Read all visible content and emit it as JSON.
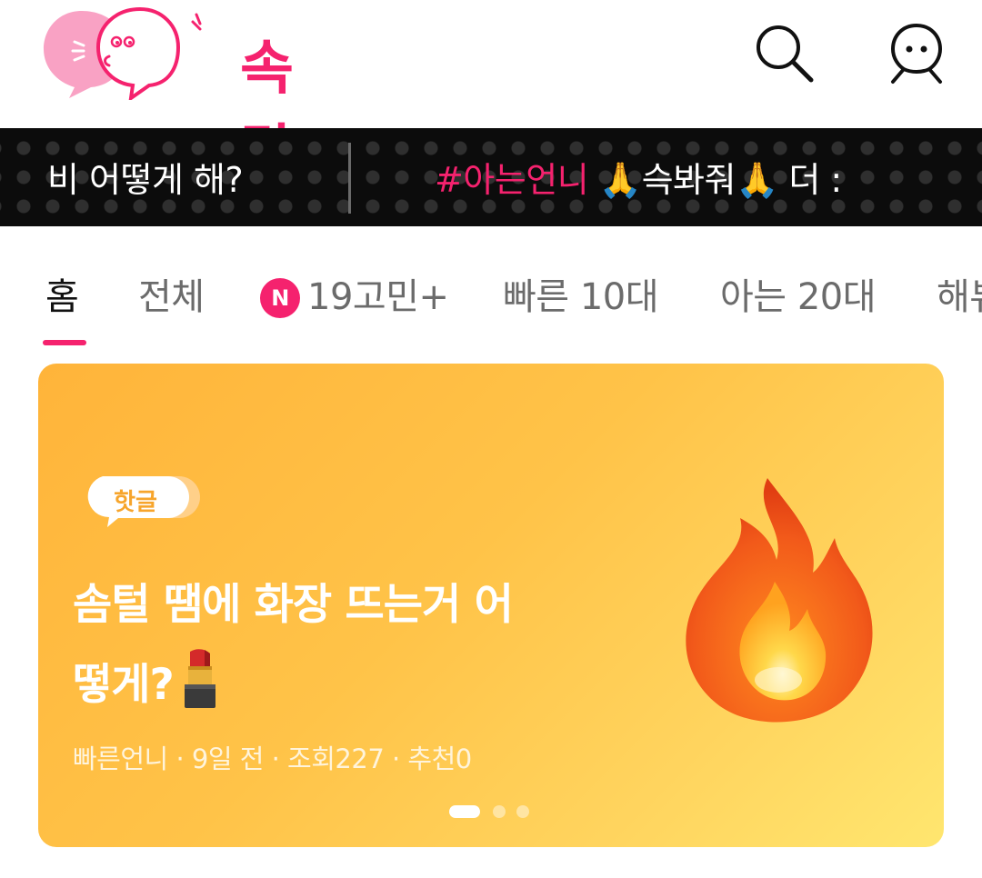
{
  "app": {
    "logo_text": "속닥",
    "icons": {
      "search": "search-icon",
      "profile": "profile-icon"
    },
    "colors": {
      "brand": "#f5226e",
      "ticker_bg": "#0c0c0c",
      "card_start": "#ffb43a",
      "card_end": "#ffe66f"
    }
  },
  "ticker": {
    "item1": "비 어떻게 해?",
    "item2_hashtag": "#아는언니",
    "item2_rest": "🙏슥봐줘🙏 더 :"
  },
  "tabs": [
    {
      "label": "홈"
    },
    {
      "label": "전체"
    },
    {
      "label": "19고민+",
      "badge": "N"
    },
    {
      "label": "빠른 10대"
    },
    {
      "label": "아는 20대"
    },
    {
      "label": "해뷰"
    }
  ],
  "hero": {
    "badge": "핫글",
    "title_line1": "솜털 땜에 화장 뜨는거 어",
    "title_line2": "떻게?",
    "meta": "빠른언니 · 9일 전 · 조회227 · 추천0",
    "icons": {
      "title_emoji": "lipstick-icon",
      "illustration": "fire-icon"
    },
    "carousel": {
      "pages": 3,
      "current": 1
    }
  }
}
